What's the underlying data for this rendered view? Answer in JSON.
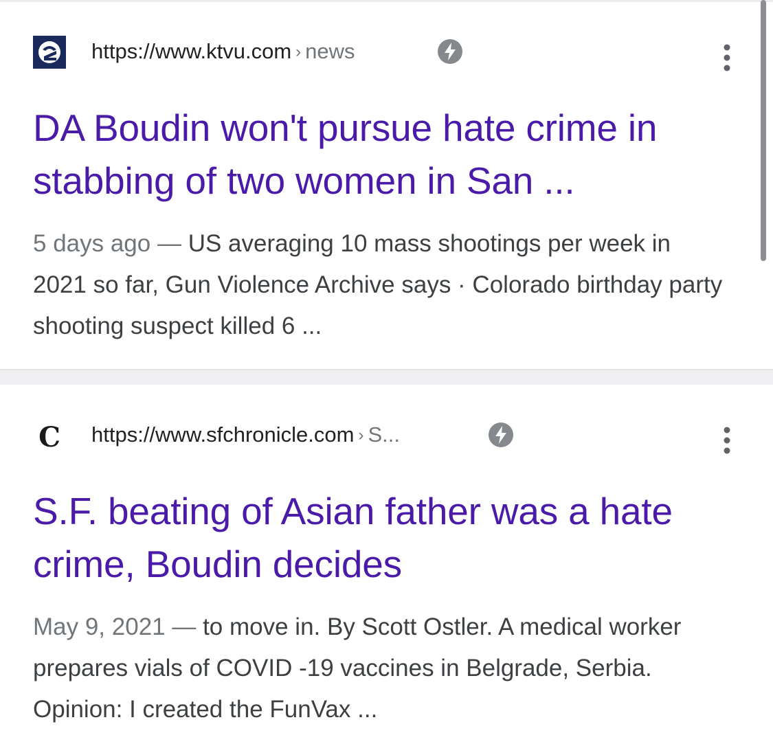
{
  "results": [
    {
      "favicon": "ktvu-logo-icon",
      "url_domain": "https://www.ktvu.com",
      "url_separator": "›",
      "url_path": "news",
      "amp_icon": "lightning-bolt-icon",
      "menu_icon": "more-vert-icon",
      "title": "DA Boudin won't pursue hate crime in stabbing of two women in San ...",
      "date": "5 days ago",
      "dash": " — ",
      "snippet": "US averaging 10 mass shootings per week in 2021 so far, Gun Violence Archive says · Colorado birthday party shooting suspect killed 6 ..."
    },
    {
      "favicon": "sf-chronicle-logo-icon",
      "favicon_glyph": "C",
      "url_domain": "https://www.sfchronicle.com",
      "url_separator": "›",
      "url_path": "S...",
      "amp_icon": "lightning-bolt-icon",
      "menu_icon": "more-vert-icon",
      "title": "S.F. beating of Asian father was a hate crime, Boudin decides",
      "date": "May 9, 2021",
      "dash": " — ",
      "snippet": "to move in. By Scott Ostler. A medical worker prepares vials of COVID -19 vaccines in Belgrade, Serbia. Opinion: I created the FunVax ..."
    }
  ],
  "colors": {
    "title_link": "#4a1aa8",
    "url_text": "#202124",
    "meta_gray": "#70757a",
    "snippet_text": "#3c4043",
    "ktvu_navy": "#1b2a5c"
  }
}
